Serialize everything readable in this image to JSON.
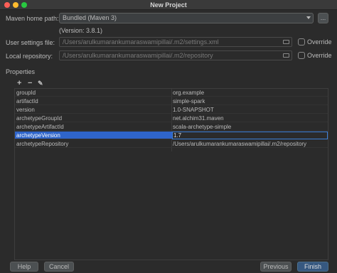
{
  "window": {
    "title": "New Project"
  },
  "maven_home": {
    "label": "Maven home path:",
    "value": "Bundled (Maven 3)",
    "browse_label": "...",
    "version": "(Version: 3.8.1)"
  },
  "user_settings": {
    "label": "User settings file:",
    "value": "/Users/arulkumarankumaraswamipillai/.m2/settings.xml",
    "override_label": "Override",
    "override_checked": false
  },
  "local_repo": {
    "label": "Local repository:",
    "value": "/Users/arulkumarankumaraswamipillai/.m2/repository",
    "override_label": "Override",
    "override_checked": false
  },
  "properties": {
    "section_label": "Properties",
    "toolbar": {
      "add": "+",
      "remove": "−",
      "edit": "✎"
    },
    "rows": [
      {
        "key": "groupId",
        "value": "org.example"
      },
      {
        "key": "artifactId",
        "value": "simple-spark"
      },
      {
        "key": "version",
        "value": "1.0-SNAPSHOT"
      },
      {
        "key": "archetypeGroupId",
        "value": "net.alchim31.maven"
      },
      {
        "key": "archetypeArtifactId",
        "value": "scala-archetype-simple"
      },
      {
        "key": "archetypeVersion",
        "value": "1.7"
      },
      {
        "key": "archetypeRepository",
        "value": "/Users/arulkumarankumaraswamipillai/.m2/repository"
      }
    ],
    "selected_row": 5
  },
  "buttons": {
    "help": "Help",
    "cancel": "Cancel",
    "previous": "Previous",
    "finish": "Finish"
  },
  "colors": {
    "background": "#2b2b2b",
    "selection": "#2f65ca",
    "primary_button": "#365880"
  }
}
